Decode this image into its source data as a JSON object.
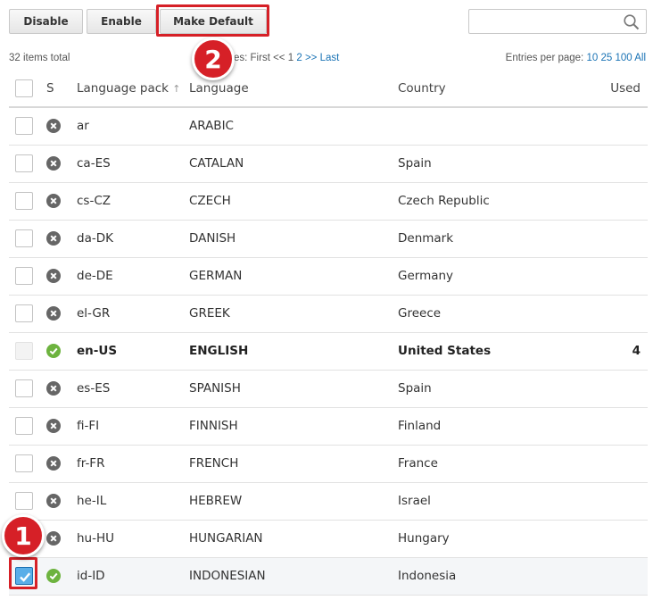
{
  "toolbar": {
    "disable_label": "Disable",
    "enable_label": "Enable",
    "make_default_label": "Make Default"
  },
  "search": {
    "placeholder": "",
    "value": ""
  },
  "summary": {
    "total": "32 items total",
    "pages_label": "es: First",
    "page_prev": "<<",
    "page_1": "1",
    "page_2": "2",
    "page_next": ">>",
    "page_last": "Last",
    "per_page_label": "Entries per page:",
    "per_page_10": "10",
    "per_page_25": "25",
    "per_page_100": "100",
    "per_page_all": "All"
  },
  "annotations": {
    "badge_1": "1",
    "badge_2": "2"
  },
  "table": {
    "headers": {
      "status": "S",
      "pack": "Language pack",
      "sort_indicator": "↑",
      "language": "Language",
      "country": "Country",
      "used": "Used"
    },
    "rows": [
      {
        "pack": "ar",
        "language": "ARABIC",
        "country": "",
        "used": "",
        "status": "disabled",
        "checked": false
      },
      {
        "pack": "ca-ES",
        "language": "CATALAN",
        "country": "Spain",
        "used": "",
        "status": "disabled",
        "checked": false
      },
      {
        "pack": "cs-CZ",
        "language": "CZECH",
        "country": "Czech Republic",
        "used": "",
        "status": "disabled",
        "checked": false
      },
      {
        "pack": "da-DK",
        "language": "DANISH",
        "country": "Denmark",
        "used": "",
        "status": "disabled",
        "checked": false
      },
      {
        "pack": "de-DE",
        "language": "GERMAN",
        "country": "Germany",
        "used": "",
        "status": "disabled",
        "checked": false
      },
      {
        "pack": "el-GR",
        "language": "GREEK",
        "country": "Greece",
        "used": "",
        "status": "disabled",
        "checked": false
      },
      {
        "pack": "en-US",
        "language": "ENGLISH",
        "country": "United States",
        "used": "4",
        "status": "enabled",
        "checked": false
      },
      {
        "pack": "es-ES",
        "language": "SPANISH",
        "country": "Spain",
        "used": "",
        "status": "disabled",
        "checked": false
      },
      {
        "pack": "fi-FI",
        "language": "FINNISH",
        "country": "Finland",
        "used": "",
        "status": "disabled",
        "checked": false
      },
      {
        "pack": "fr-FR",
        "language": "FRENCH",
        "country": "France",
        "used": "",
        "status": "disabled",
        "checked": false
      },
      {
        "pack": "he-IL",
        "language": "HEBREW",
        "country": "Israel",
        "used": "",
        "status": "disabled",
        "checked": false
      },
      {
        "pack": "hu-HU",
        "language": "HUNGARIAN",
        "country": "Hungary",
        "used": "",
        "status": "disabled",
        "checked": false
      },
      {
        "pack": "id-ID",
        "language": "INDONESIAN",
        "country": "Indonesia",
        "used": "",
        "status": "enabled",
        "checked": true
      }
    ]
  },
  "colors": {
    "accent_red": "#d62027",
    "status_enabled": "#6db33f",
    "status_disabled": "#666666",
    "link": "#1a73b5",
    "checkbox_checked": "#5aaee8"
  }
}
